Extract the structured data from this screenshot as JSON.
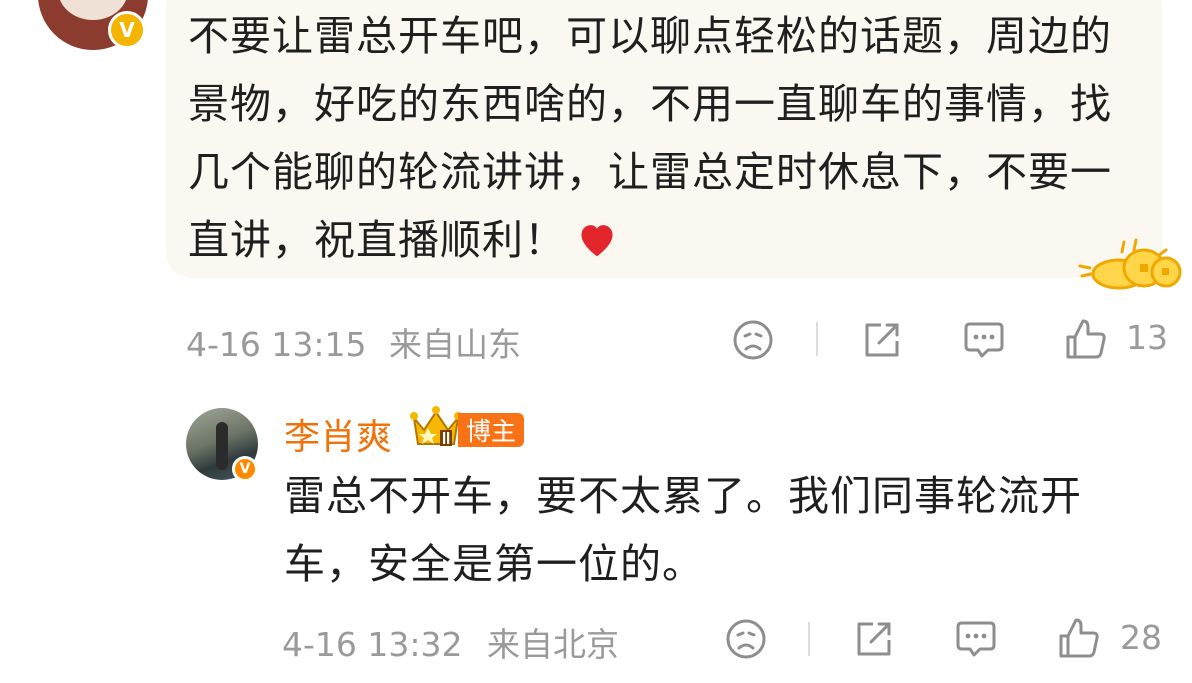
{
  "comment1": {
    "text": "不要让雷总开车吧，可以聊点轻松的话题，周边的景物，好吃的东西啥的，不用一直聊车的事情，找几个能聊的轮流讲讲，让雷总定时休息下，不要一直讲，祝直播顺利！",
    "date": "4-16 13:15",
    "location": "来自山东",
    "like_count": "13"
  },
  "reply": {
    "username": "李肖爽",
    "badge": "博主",
    "text": "雷总不开车，要不太累了。我们同事轮流开车，安全是第一位的。",
    "date": "4-16 13:32",
    "location": "来自北京",
    "like_count": "28"
  },
  "icons": {
    "dislike": "frown-face-icon",
    "share": "share-icon",
    "reply": "comment-bubble-icon",
    "like": "thumbs-up-icon",
    "heart": "red-heart-emoji",
    "verified": "verified-v-icon"
  },
  "verified_letter": "V",
  "colors": {
    "accent_orange": "#f0720a",
    "card_bg": "#fbf8f2",
    "meta_gray": "#9a9a9a",
    "verified_gold": "#f5b400"
  }
}
